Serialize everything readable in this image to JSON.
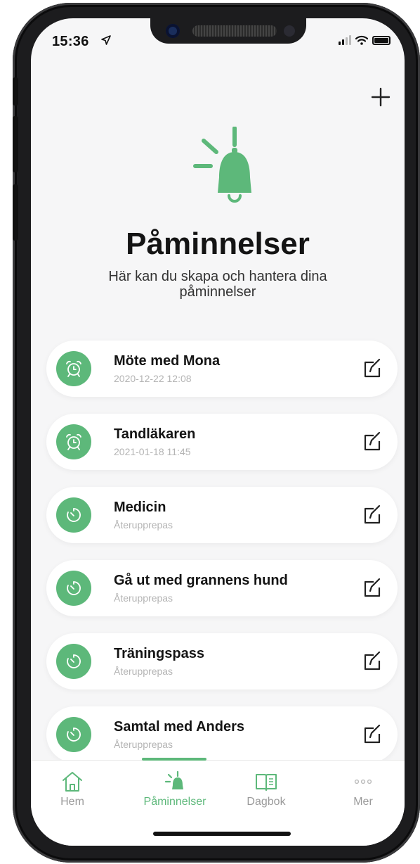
{
  "status_bar": {
    "time": "15:36",
    "location_icon": "location-arrow-icon"
  },
  "header": {
    "add_icon": "plus-icon"
  },
  "hero": {
    "icon": "bell-icon",
    "title": "Påminnelser",
    "subtitle": "Här kan du skapa och hantera dina påminnelser"
  },
  "colors": {
    "accent": "#5db87a",
    "background": "#f6f6f7",
    "muted_text": "#b4b4b4"
  },
  "reminders": [
    {
      "title": "Möte med Mona",
      "subtitle": "2020-12-22 12:08",
      "icon": "alarm-clock-icon"
    },
    {
      "title": "Tandläkaren",
      "subtitle": "2021-01-18 11:45",
      "icon": "alarm-clock-icon"
    },
    {
      "title": "Medicin",
      "subtitle": "Återupprepas",
      "icon": "repeat-timer-icon"
    },
    {
      "title": "Gå ut med grannens hund",
      "subtitle": "Återupprepas",
      "icon": "repeat-timer-icon"
    },
    {
      "title": "Träningspass",
      "subtitle": "Återupprepas",
      "icon": "repeat-timer-icon"
    },
    {
      "title": "Samtal med Anders",
      "subtitle": "Återupprepas",
      "icon": "repeat-timer-icon"
    }
  ],
  "tab_bar": {
    "tabs": [
      {
        "label": "Hem",
        "icon": "home-icon"
      },
      {
        "label": "Påminnelser",
        "icon": "bell-icon",
        "active": true
      },
      {
        "label": "Dagbok",
        "icon": "book-icon"
      },
      {
        "label": "Mer",
        "icon": "more-dots-icon"
      }
    ]
  }
}
